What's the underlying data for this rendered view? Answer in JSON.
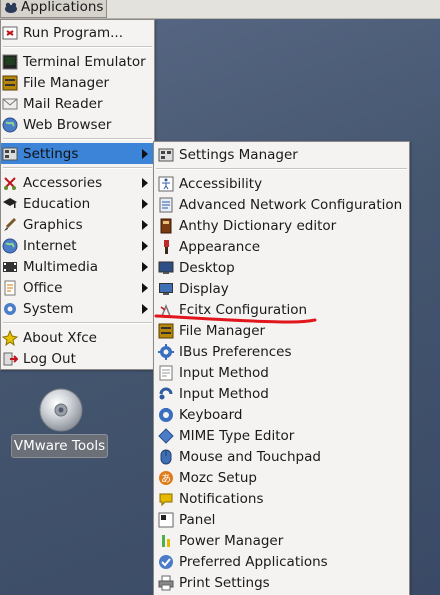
{
  "panel": {
    "applications_label": "Applications"
  },
  "main_menu": {
    "items": [
      {
        "label": "Run Program...",
        "icon": "run-icon"
      },
      {
        "label": "Terminal Emulator",
        "icon": "terminal-icon"
      },
      {
        "label": "File Manager",
        "icon": "file-manager-icon"
      },
      {
        "label": "Mail Reader",
        "icon": "mail-icon"
      },
      {
        "label": "Web Browser",
        "icon": "web-browser-icon"
      },
      {
        "label": "Settings",
        "icon": "settings-icon",
        "submenu": true
      },
      {
        "label": "Accessories",
        "icon": "accessories-icon",
        "submenu": true
      },
      {
        "label": "Education",
        "icon": "education-icon",
        "submenu": true
      },
      {
        "label": "Graphics",
        "icon": "graphics-icon",
        "submenu": true
      },
      {
        "label": "Internet",
        "icon": "internet-icon",
        "submenu": true
      },
      {
        "label": "Multimedia",
        "icon": "multimedia-icon",
        "submenu": true
      },
      {
        "label": "Office",
        "icon": "office-icon",
        "submenu": true
      },
      {
        "label": "System",
        "icon": "system-icon",
        "submenu": true
      },
      {
        "label": "About Xfce",
        "icon": "about-icon"
      },
      {
        "label": "Log Out",
        "icon": "logout-icon"
      }
    ]
  },
  "settings_menu": {
    "items": [
      {
        "label": "Settings Manager",
        "icon": "settings-manager-icon"
      },
      {
        "label": "Accessibility",
        "icon": "accessibility-icon"
      },
      {
        "label": "Advanced Network Configuration",
        "icon": "network-icon"
      },
      {
        "label": "Anthy Dictionary editor",
        "icon": "dictionary-icon"
      },
      {
        "label": "Appearance",
        "icon": "appearance-icon"
      },
      {
        "label": "Desktop",
        "icon": "desktop-icon"
      },
      {
        "label": "Display",
        "icon": "display-icon"
      },
      {
        "label": "Fcitx Configuration",
        "icon": "fcitx-icon"
      },
      {
        "label": "File Manager",
        "icon": "file-manager-icon"
      },
      {
        "label": "IBus Preferences",
        "icon": "ibus-icon"
      },
      {
        "label": "Input Method",
        "icon": "input-method-icon"
      },
      {
        "label": "Input Method",
        "icon": "input-method-icon"
      },
      {
        "label": "Keyboard",
        "icon": "keyboard-icon"
      },
      {
        "label": "MIME Type Editor",
        "icon": "mime-icon"
      },
      {
        "label": "Mouse and Touchpad",
        "icon": "mouse-icon"
      },
      {
        "label": "Mozc Setup",
        "icon": "mozc-icon"
      },
      {
        "label": "Notifications",
        "icon": "notifications-icon"
      },
      {
        "label": "Panel",
        "icon": "panel-icon"
      },
      {
        "label": "Power Manager",
        "icon": "power-icon"
      },
      {
        "label": "Preferred Applications",
        "icon": "preferred-apps-icon"
      },
      {
        "label": "Print Settings",
        "icon": "print-icon"
      }
    ]
  },
  "desktop": {
    "vmware_tools_label": "VMware Tools"
  },
  "colors": {
    "highlight": "#3b84d8",
    "annotation": "#e0161c"
  }
}
